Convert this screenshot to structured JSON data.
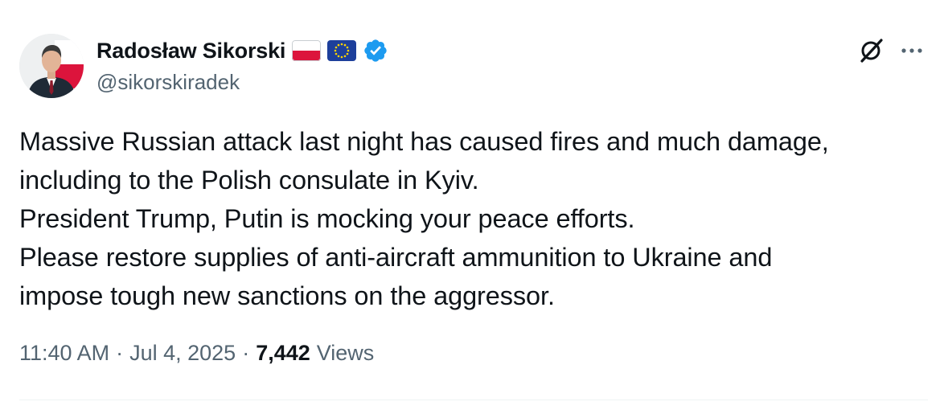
{
  "author": {
    "display_name": "Radosław Sikorski",
    "handle": "@sikorskiradek",
    "flags": [
      "poland-flag",
      "eu-flag"
    ],
    "verified": true,
    "verified_color": "#1d9bf0"
  },
  "tweet": {
    "lines": [
      "Massive Russian attack last night has caused fires and much damage,",
      "including to the Polish consulate in Kyiv.",
      "President Trump, Putin is mocking your peace efforts.",
      "Please restore supplies of anti-aircraft ammunition to Ukraine and",
      "impose tough new sanctions on the aggressor."
    ]
  },
  "meta": {
    "time": "11:40 AM",
    "separator": "·",
    "date": "Jul 4, 2025",
    "views_count": "7,442",
    "views_label": "Views"
  },
  "icons": {
    "grok": "grok-icon",
    "more": "more-options-icon"
  },
  "colors": {
    "text": "#0f1419",
    "secondary": "#536471",
    "divider": "#eff3f4"
  }
}
